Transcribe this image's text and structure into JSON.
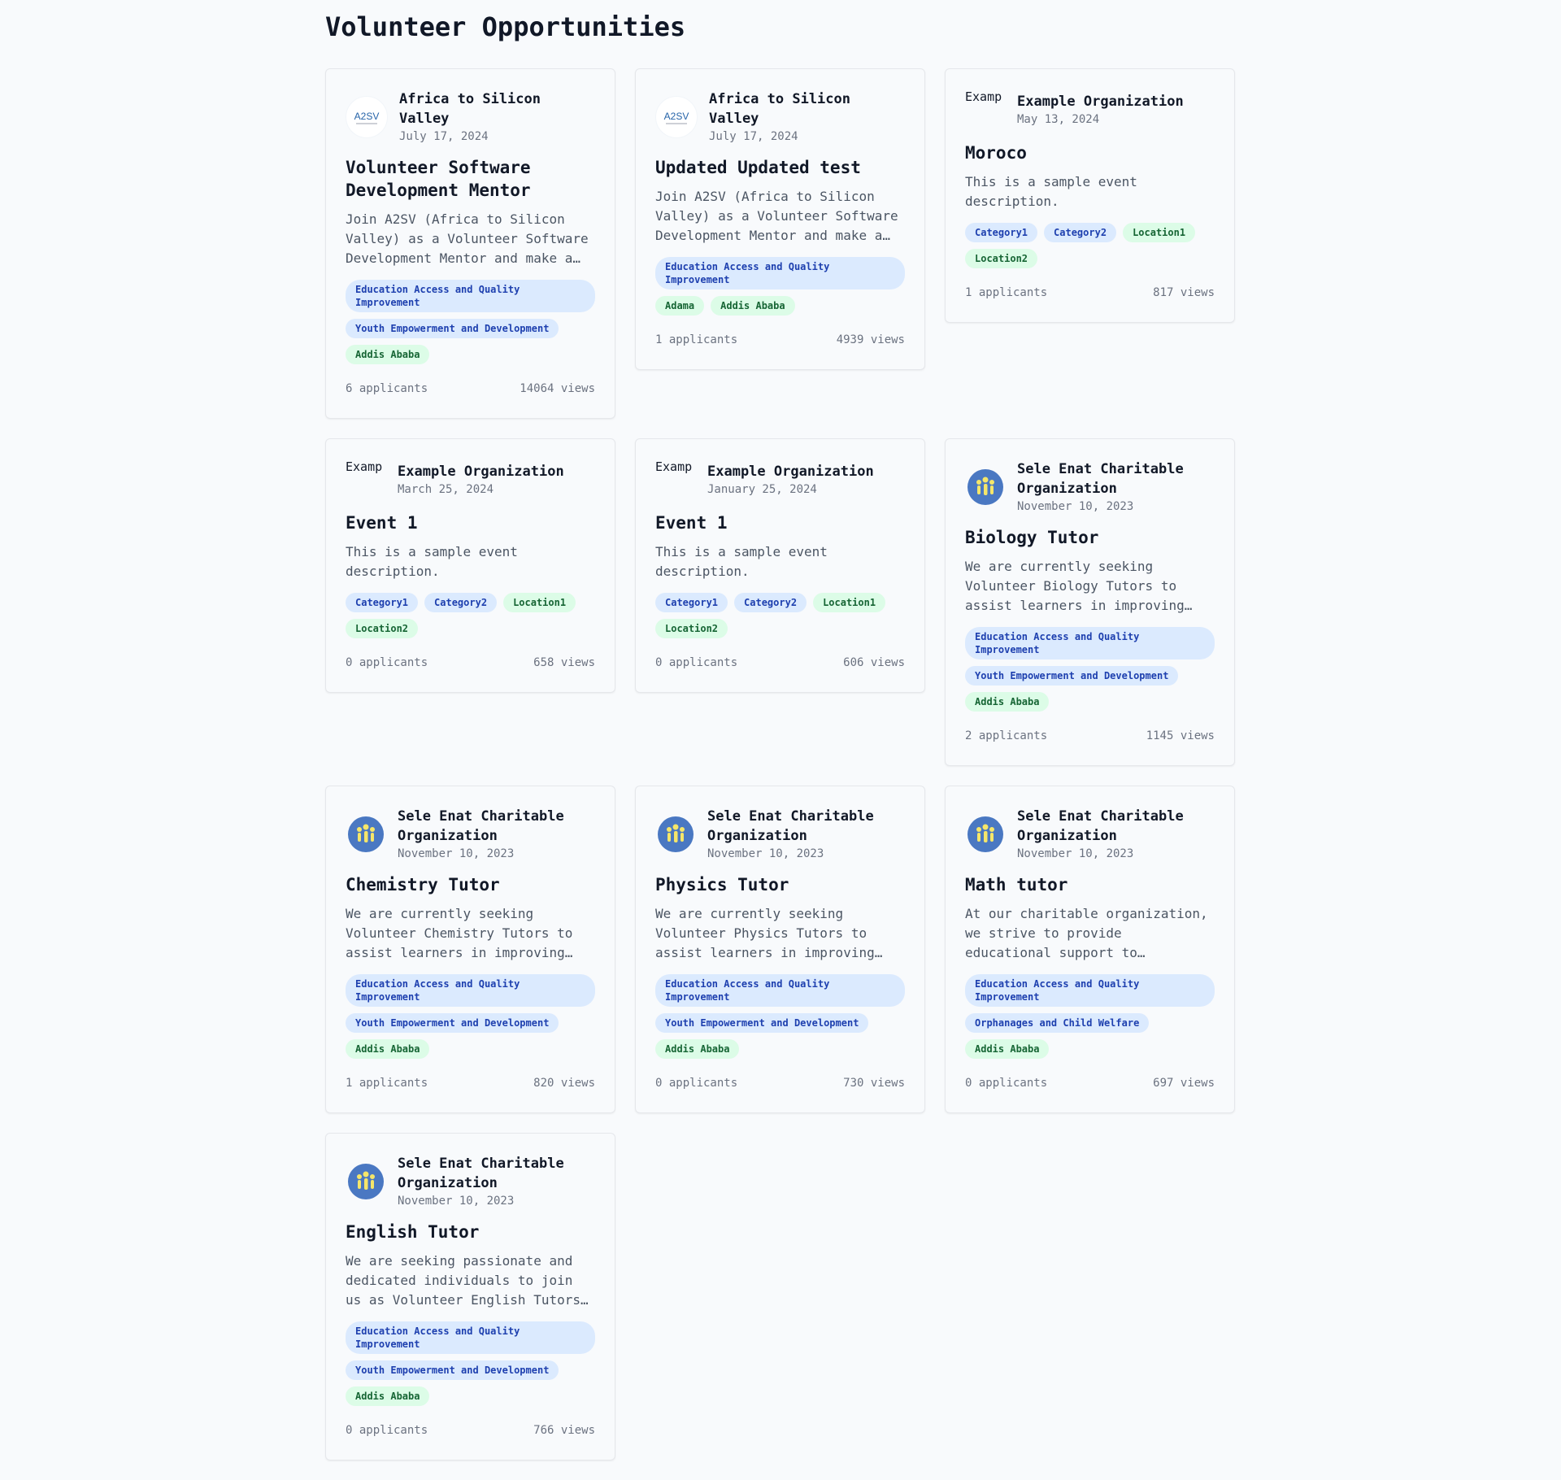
{
  "page_title": "Volunteer Opportunities",
  "cards": [
    {
      "org": "Africa to Silicon Valley",
      "date": "July 17, 2024",
      "title": "Volunteer Software Development Mentor",
      "desc": "Join A2SV (Africa to Silicon Valley) as a Volunteer Software Development Mentor and make a…",
      "tags": [
        "Education Access and Quality Improvement",
        "Youth Empowerment and Development",
        "Addis Ababa"
      ],
      "applicants": "6 applicants",
      "views": "14064 views"
    },
    {
      "org": "Africa to Silicon Valley",
      "date": "July 17, 2024",
      "title": "Updated Updated test",
      "desc": "Join A2SV (Africa to Silicon Valley) as a Volunteer Software Development Mentor and make a…",
      "tags": [
        "Education Access and Quality Improvement",
        "Adama",
        "Addis Ababa"
      ],
      "applicants": "1 applicants",
      "views": "4939 views"
    },
    {
      "org": "Example Organization",
      "date": "May 13, 2024",
      "title": "Moroco",
      "desc": "This is a sample event description.",
      "tags": [
        "Category1",
        "Category2",
        "Location1",
        "Location2"
      ],
      "applicants": "1 applicants",
      "views": "817 views"
    },
    {
      "org": "Example Organization",
      "date": "March 25, 2024",
      "title": "Event 1",
      "desc": "This is a sample event description.",
      "tags": [
        "Category1",
        "Category2",
        "Location1",
        "Location2"
      ],
      "applicants": "0 applicants",
      "views": "658 views"
    },
    {
      "org": "Example Organization",
      "date": "January 25, 2024",
      "title": "Event 1",
      "desc": "This is a sample event description.",
      "tags": [
        "Category1",
        "Category2",
        "Location1",
        "Location2"
      ],
      "applicants": "0 applicants",
      "views": "606 views"
    },
    {
      "org": "Sele Enat Charitable Organization",
      "date": "November 10, 2023",
      "title": "Biology Tutor",
      "desc": "We are currently seeking Volunteer Biology Tutors to assist learners in improving…",
      "tags": [
        "Education Access and Quality Improvement",
        "Youth Empowerment and Development",
        "Addis Ababa"
      ],
      "applicants": "2 applicants",
      "views": "1145 views"
    },
    {
      "org": "Sele Enat Charitable Organization",
      "date": "November 10, 2023",
      "title": "Chemistry Tutor",
      "desc": "We are currently seeking Volunteer Chemistry Tutors to assist learners in improving…",
      "tags": [
        "Education Access and Quality Improvement",
        "Youth Empowerment and Development",
        "Addis Ababa"
      ],
      "applicants": "1 applicants",
      "views": "820 views"
    },
    {
      "org": "Sele Enat Charitable Organization",
      "date": "November 10, 2023",
      "title": "Physics Tutor",
      "desc": "We are currently seeking Volunteer Physics Tutors to assist learners in improving…",
      "tags": [
        "Education Access and Quality Improvement",
        "Youth Empowerment and Development",
        "Addis Ababa"
      ],
      "applicants": "0 applicants",
      "views": "730 views"
    },
    {
      "org": "Sele Enat Charitable Organization",
      "date": "November 10, 2023",
      "title": "Math tutor",
      "desc": "At our charitable organization, we strive to provide educational support to…",
      "tags": [
        "Education Access and Quality Improvement",
        "Orphanages and Child Welfare",
        "Addis Ababa"
      ],
      "applicants": "0 applicants",
      "views": "697 views"
    },
    {
      "org": "Sele Enat Charitable Organization",
      "date": "November 10, 2023",
      "title": "English Tutor",
      "desc": "We are seeking passionate and dedicated individuals to join us as Volunteer English Tutors…",
      "tags": [
        "Education Access and Quality Improvement",
        "Youth Empowerment and Development",
        "Addis Ababa"
      ],
      "applicants": "0 applicants",
      "views": "766 views"
    }
  ],
  "logos": {
    "a2sv_text": "A2SV",
    "broken_alt": "Examp"
  },
  "colors": {
    "category_tag_bg": "#dbeafe",
    "category_tag_text": "#1e40af",
    "location_tag_bg": "#dcfce7",
    "location_tag_text": "#166534",
    "sele_logo_blue": "#4a78c2",
    "sele_logo_yellow": "#f5e66a"
  }
}
